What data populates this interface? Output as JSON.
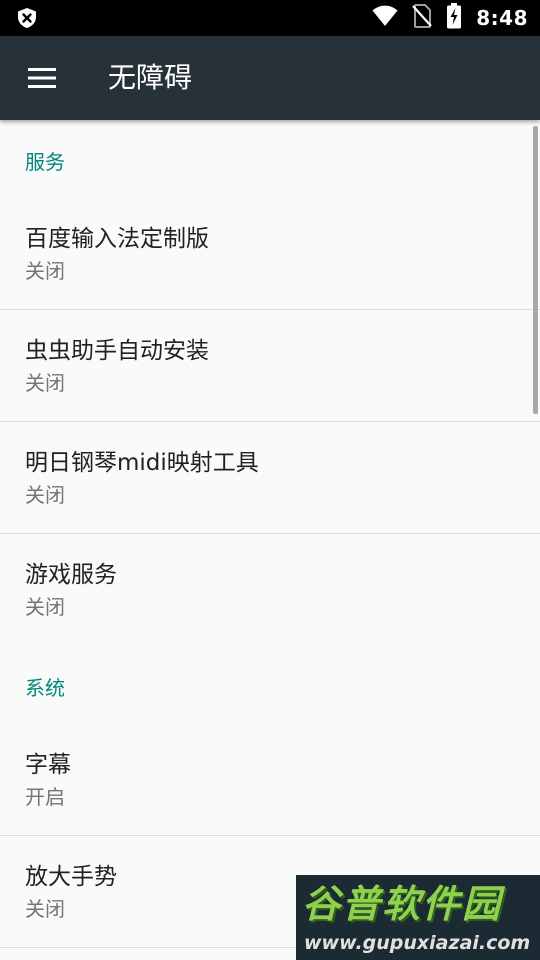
{
  "status_bar": {
    "time": "8:48",
    "icons": [
      "shield-close-icon",
      "wifi-icon",
      "no-sim-icon",
      "battery-charging-icon"
    ]
  },
  "toolbar": {
    "title": "无障碍",
    "menu_icon": "hamburger-menu-icon"
  },
  "sections": [
    {
      "header": "服务",
      "items": [
        {
          "title": "百度输入法定制版",
          "summary": "关闭"
        },
        {
          "title": "虫虫助手自动安装",
          "summary": "关闭"
        },
        {
          "title": "明日钢琴midi映射工具",
          "summary": "关闭"
        },
        {
          "title": "游戏服务",
          "summary": "关闭"
        }
      ]
    },
    {
      "header": "系统",
      "items": [
        {
          "title": "字幕",
          "summary": "开启"
        },
        {
          "title": "放大手势",
          "summary": "关闭"
        }
      ]
    }
  ],
  "watermark": {
    "logo_text": "谷普软件园",
    "url": "www.gupuxiazai.com"
  },
  "colors": {
    "toolbar": "#263238",
    "status_bar": "#000000",
    "accent": "#00897b",
    "background": "#fafafa"
  }
}
